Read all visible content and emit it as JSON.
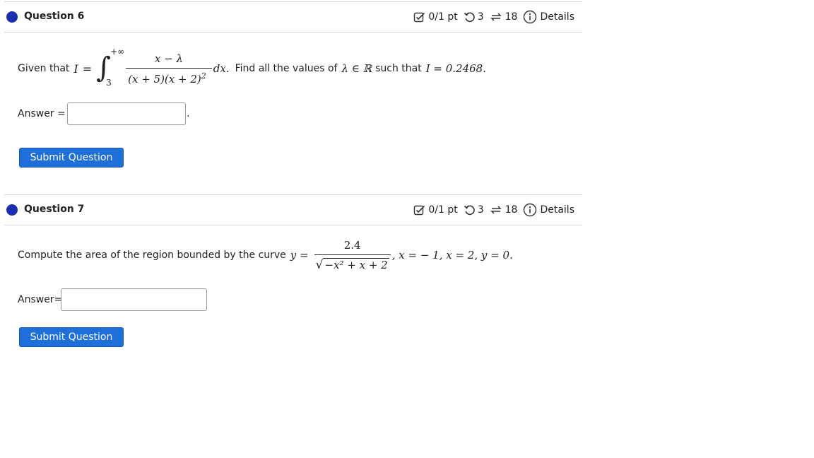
{
  "questions": [
    {
      "title": "Question 6",
      "score": "0/1 pt",
      "attempts": "3",
      "versions": "18",
      "details": "Details",
      "prompt_prefix": "Given that",
      "integral_var": "I",
      "eq": "=",
      "upper_limit": "+∞",
      "lower_limit": "3",
      "numerator": "x − λ",
      "denominator": "(x + 5)(x + 2)",
      "denominator_exp": "2",
      "dx": "dx.",
      "prompt_mid": "Find all the values of",
      "lambda_in_R": "λ ∈ ℝ",
      "prompt_mid2": "such that",
      "condition": "I = 0.2468.",
      "answer_label": "Answer =",
      "answer_suffix": ".",
      "answer_value": "",
      "submit_label": "Submit Question"
    },
    {
      "title": "Question 7",
      "score": "0/1 pt",
      "attempts": "3",
      "versions": "18",
      "details": "Details",
      "prompt_prefix": "Compute the area of the region bounded by the curve",
      "curve_lhs": "y =",
      "numerator": "2.4",
      "radicand": "−x² + x + 2",
      "bounds": ", x = − 1, x = 2, y = 0.",
      "answer_label": "Answer=",
      "answer_value": "",
      "submit_label": "Submit Question"
    }
  ],
  "icons": {
    "score": "checkbox-icon",
    "attempts": "retry-icon",
    "versions": "versions-icon",
    "details": "info-icon"
  },
  "colors": {
    "accent_dot": "#1a2fb0",
    "button_bg": "#1e6fd9",
    "button_text": "#ffffff",
    "divider": "#d9d9d9"
  }
}
